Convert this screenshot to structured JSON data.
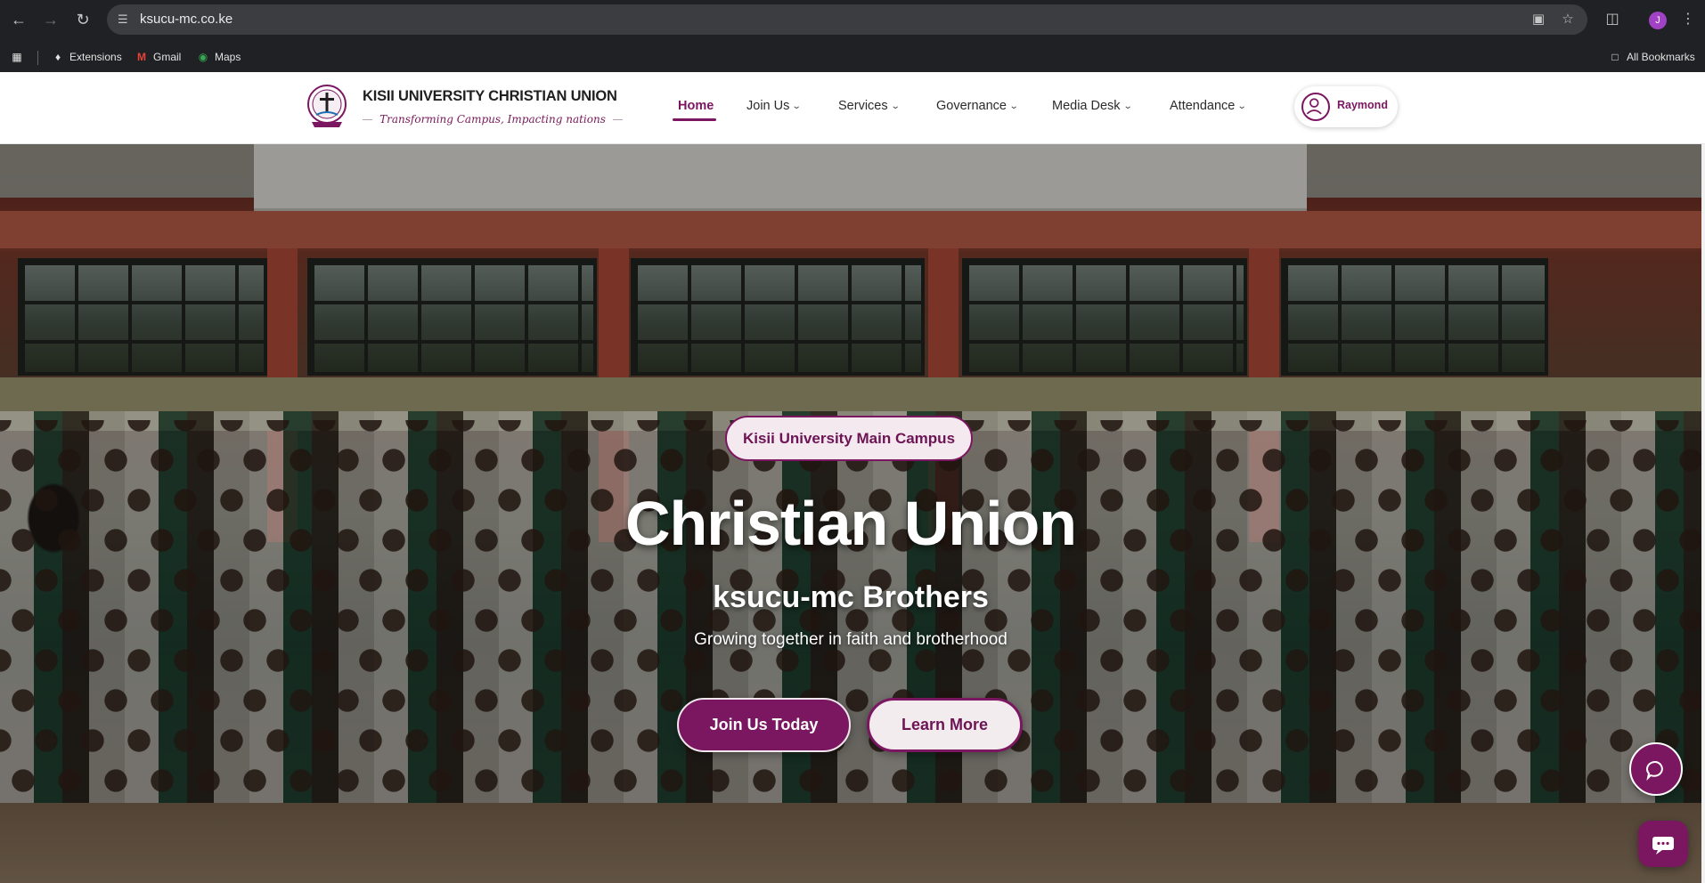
{
  "browser": {
    "url": "ksucu-mc.co.ke",
    "profile_initial": "J",
    "bookmarks": [
      {
        "label": "Extensions",
        "icon": "puzzle-icon"
      },
      {
        "label": "Gmail",
        "icon": "gmail-icon"
      },
      {
        "label": "Maps",
        "icon": "maps-pin-icon"
      }
    ],
    "all_bookmarks_label": "All Bookmarks"
  },
  "site": {
    "brand_title": "KISII UNIVERSITY CHRISTIAN UNION",
    "tagline": "Transforming Campus, Impacting nations",
    "nav": [
      {
        "label": "Home",
        "active": true
      },
      {
        "label": "Join Us"
      },
      {
        "label": "Services"
      },
      {
        "label": "Governance"
      },
      {
        "label": "Media Desk"
      },
      {
        "label": "Attendance"
      }
    ],
    "user_name": "Raymond",
    "accent_color": "#7b1660"
  },
  "hero": {
    "campus_badge": "Kisii University Main Campus",
    "title": "Christian Union",
    "subtitle": "ksucu-mc Brothers",
    "tagline": "Growing together in faith and brotherhood",
    "primary_button": "Join Us Today",
    "secondary_button": "Learn More",
    "chat_icon": "chat-bubble-icon",
    "support_icon": "support-chat-icon"
  }
}
